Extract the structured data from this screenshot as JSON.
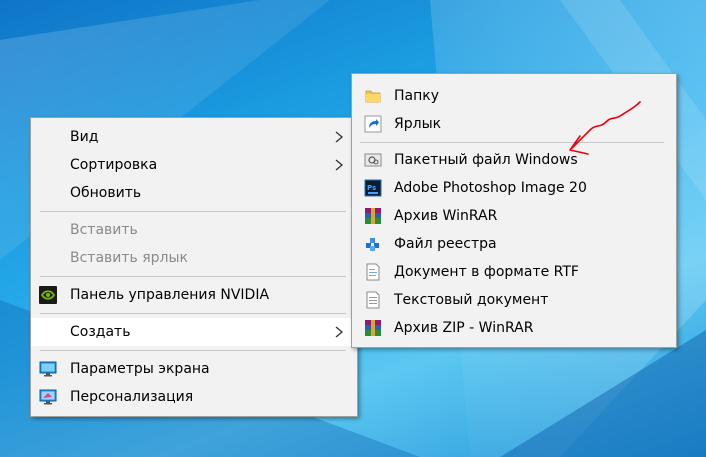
{
  "context_menu": {
    "items": [
      {
        "label": "Вид",
        "submenu": true
      },
      {
        "label": "Сортировка",
        "submenu": true
      },
      {
        "label": "Обновить"
      },
      {
        "label": "Вставить",
        "disabled": true
      },
      {
        "label": "Вставить ярлык",
        "disabled": true
      },
      {
        "label": "Панель управления NVIDIA",
        "icon": "nvidia-icon"
      },
      {
        "label": "Создать",
        "submenu": true,
        "highlighted": true
      },
      {
        "label": "Параметры экрана",
        "icon": "display-settings-icon"
      },
      {
        "label": "Персонализация",
        "icon": "personalization-icon"
      }
    ]
  },
  "create_submenu": {
    "items": [
      {
        "label": "Папку",
        "icon": "folder-icon"
      },
      {
        "label": "Ярлык",
        "icon": "shortcut-icon"
      },
      {
        "label": "Пакетный файл Windows",
        "icon": "batch-file-icon"
      },
      {
        "label": "Adobe Photoshop Image 20",
        "icon": "photoshop-icon"
      },
      {
        "label": "Архив WinRAR",
        "icon": "winrar-icon"
      },
      {
        "label": "Файл реестра",
        "icon": "registry-icon"
      },
      {
        "label": "Документ в формате RTF",
        "icon": "rtf-document-icon"
      },
      {
        "label": "Текстовый документ",
        "icon": "text-document-icon"
      },
      {
        "label": "Архив ZIP - WinRAR",
        "icon": "winrar-zip-icon"
      }
    ]
  },
  "annotation": {
    "color": "#e8000b",
    "meaning": "red hand-drawn arrow pointing at batch file item"
  },
  "colors": {
    "menu_bg": "#f2f2f2",
    "highlight_bg": "#ffffff",
    "disabled_text": "#8a8a8a",
    "desktop_blue": "#1a9ae0"
  }
}
